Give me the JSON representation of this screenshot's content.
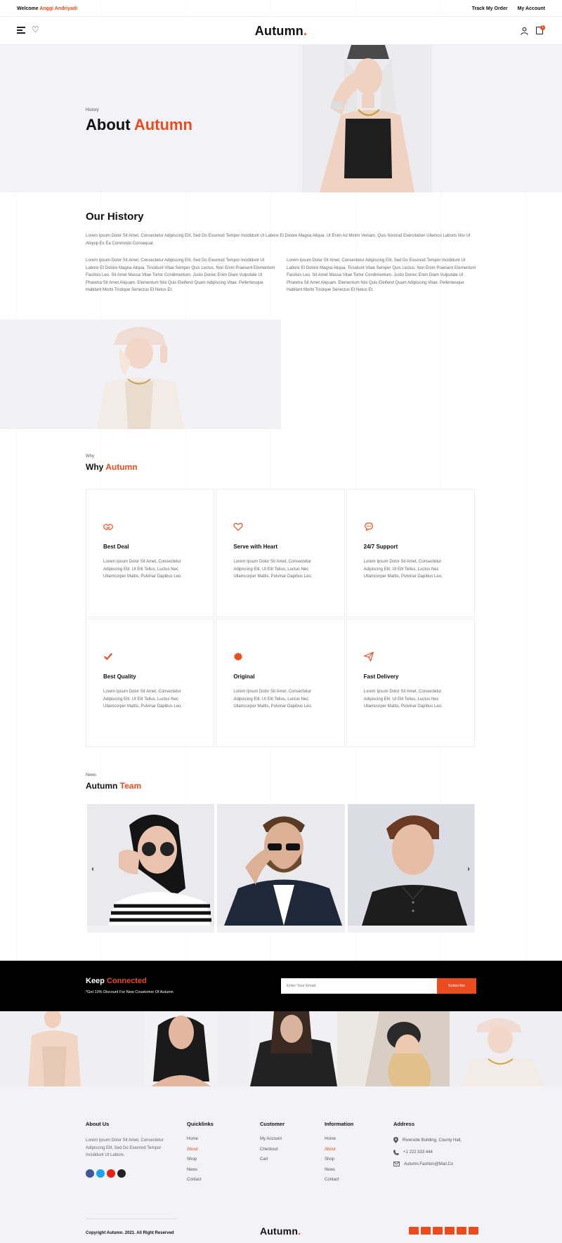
{
  "topbar": {
    "welcome_prefix": "Welcome",
    "welcome_name": "Anggi Andriyadi",
    "track_order": "Track My Order",
    "my_account": "My Account"
  },
  "header": {
    "logo": "Autumn",
    "logo_dot": ".",
    "cart_count": "1",
    "icons": [
      "menu-icon",
      "heart-icon",
      "user-icon",
      "bag-icon"
    ]
  },
  "hero": {
    "breadcrumb": "History",
    "title_main": "About",
    "title_accent": "Autumn"
  },
  "history": {
    "title": "Our History",
    "intro": "Lorem Ipsum Dolor Sit Amet, Consectetur Adipiscing Elit, Sed Do Eiusmod Tempor Incididunt Ut Labore Et Dolore Magna Aliqua. Ut Enim Ad Minim Veniam, Quis Nostrud Exercitation Ullamco Laboris Nisi Ut Aliquip Ex Ea Commodo Consequat.",
    "col1": "Lorem Ipsum Dolor Sit Amet, Consectetur Adipiscing Elit, Sed Do Eiusmod Tempor Incididunt Ut Labore Et Dolore Magna Aliqua. Tincidunt Vitae Semper Quis Lectus. Non Enim Praesent Elementum Facilisis Leo. Sit Amet Massa Vitae Tortor Condimentum. Justo Donec Enim Diam Vulputate Ut Pharetra Sit Amet Aliquam. Elementum Nisi Quis Eleifend Quam Adipiscing Vitae. Pellentesque Habitant Morbi Tristique Senectus Et Netus Et.",
    "col2": "Lorem Ipsum Dolor Sit Amet, Consectetur Adipiscing Elit, Sed Do Eiusmod Tempor Incididunt Ut Labore Et Dolore Magna Aliqua. Tincidunt Vitae Semper Quis Lectus. Non Enim Praesent Elementum Facilisis Leo. Sit Amet Massa Vitae Tortor Condimentum. Justo Donec Enim Diam Vulputate Ut Pharetra Sit Amet Aliquam. Elementum Nisi Quis Eleifend Quam Adipiscing Vitae. Pellentesque Habitant Morbi Tristique Senectus Et Netus Et."
  },
  "why": {
    "subtitle": "Why",
    "title_main": "Why",
    "title_accent": "Autumn",
    "features": [
      {
        "icon": "handshake-icon",
        "title": "Best Deal",
        "text": "Lorem Ipsum Dolor Sit Amet, Consectetur Adipiscing Elit. Ut Elit Tellus, Luctus Nec Ullamcorper Mattis, Pulvinar Dapibus Leo."
      },
      {
        "icon": "heart-icon",
        "title": "Serve with Heart",
        "text": "Lorem Ipsum Dolor Sit Amet, Consectetur Adipiscing Elit. Ut Elit Tellus, Luctus Nec Ullamcorper Mattis, Pulvinar Dapibus Leo."
      },
      {
        "icon": "chat-icon",
        "title": "24/7 Support",
        "text": "Lorem Ipsum Dolor Sit Amet, Consectetur Adipiscing Elit. Ut Elit Tellus, Luctus Nec Ullamcorper Mattis, Pulvinar Dapibus Leo."
      },
      {
        "icon": "check-icon",
        "title": "Best Quality",
        "text": "Lorem Ipsum Dolor Sit Amet, Consectetur Adipiscing Elit. Ut Elit Tellus, Luctus Nec Ullamcorper Mattis, Pulvinar Dapibus Leo."
      },
      {
        "icon": "badge-icon",
        "title": "Original",
        "text": "Lorem Ipsum Dolor Sit Amet, Consectetur Adipiscing Elit. Ut Elit Tellus, Luctus Nec Ullamcorper Mattis, Pulvinar Dapibus Leo."
      },
      {
        "icon": "paper-plane-icon",
        "title": "Fast Delivery",
        "text": "Lorem Ipsum Dolor Sit Amet, Consectetur Adipiscing Elit. Ut Elit Tellus, Luctus Nec Ullamcorper Mattis, Pulvinar Dapibus Leo."
      }
    ]
  },
  "team": {
    "subtitle": "News",
    "title_main": "Autumn",
    "title_accent": "Team",
    "prev": "‹",
    "next": "›"
  },
  "newsletter": {
    "title_main": "Keep",
    "title_accent": "Connected",
    "note": "*Get 10% Discount For New Coustomer Of Autumn",
    "placeholder": "Enter Your Email..",
    "button": "Subscribe"
  },
  "footer": {
    "about_title": "About Us",
    "about_text": "Lorem Ipsum Dolor Sit Amet, Consectetur Adipiscing Elit, Sed Do Eiusmod Tempor Incididunt Ut Labore.",
    "quicklinks_title": "Quicklinks",
    "quicklinks": [
      "Home",
      "About",
      "Shop",
      "News",
      "Contact"
    ],
    "customer_title": "Customer",
    "customer": [
      "My Account",
      "Checkout",
      "Cart"
    ],
    "information_title": "Information",
    "information": [
      "Home",
      "About",
      "Shop",
      "News",
      "Contact"
    ],
    "address_title": "Address",
    "address": "Riverside Building, County Hall,",
    "phone": "+1 222 333 444",
    "email": "Autumn.Fashion@Mail.Co",
    "copyright": "Copyright Autumn. 2021. All Right Reserved",
    "logo": "Autumn",
    "logo_dot": ".",
    "social_colors": [
      "#3b5998",
      "#1da1f2",
      "#e62117",
      "#222222"
    ],
    "accent_color": "#ea4c1f"
  }
}
